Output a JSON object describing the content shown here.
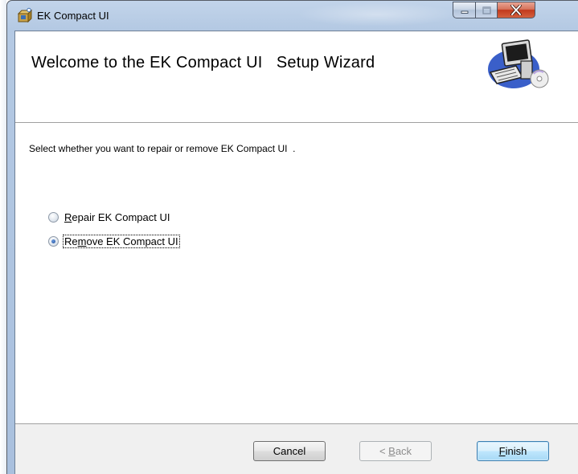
{
  "window": {
    "title": "EK Compact UI",
    "app_icon": "installer-box-icon",
    "controls": [
      "minimize-icon",
      "maximize-icon",
      "close-icon"
    ]
  },
  "banner": {
    "title": "Welcome to the EK Compact UI   Setup Wizard",
    "art": "computer-with-cd-icon"
  },
  "body": {
    "prompt": "Select whether you want to repair or remove EK Compact UI  .",
    "options": [
      {
        "mnemonic": "R",
        "rest": "epair EK Compact UI",
        "selected": false
      },
      {
        "pre": "Re",
        "mnemonic": "m",
        "rest": "ove EK Compact UI",
        "selected": true
      }
    ]
  },
  "footer": {
    "cancel": "Cancel",
    "back_pre": "< ",
    "back_mnemonic": "B",
    "back_rest": "ack",
    "finish_mnemonic": "F",
    "finish_rest": "inish"
  },
  "colors": {
    "titlebar": "#b4c9e3",
    "close_button": "#c2391c",
    "footer_bg": "#f0f0f0",
    "default_button": "#bee6fd"
  }
}
